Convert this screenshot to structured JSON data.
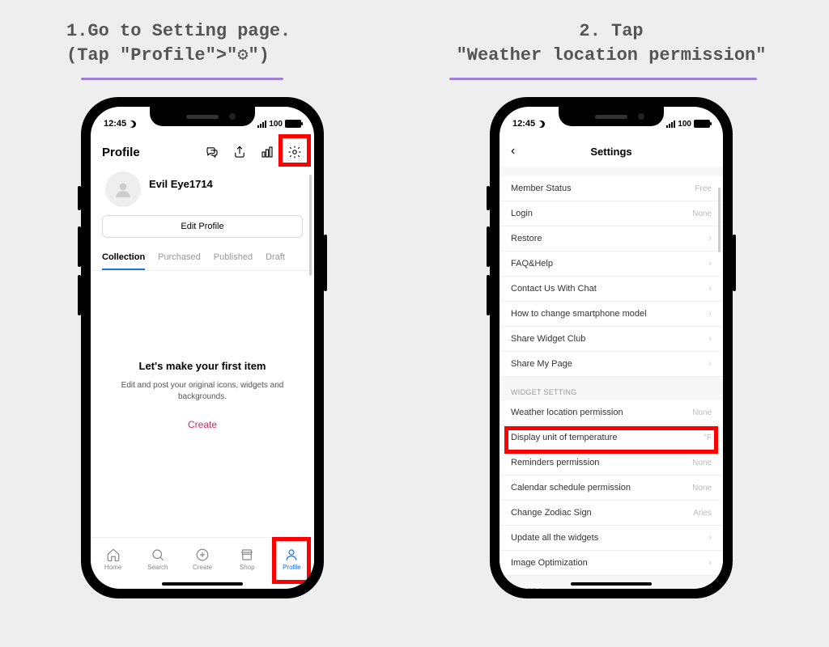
{
  "instructions": {
    "step1_line1": "1.Go to Setting page.",
    "step1_line2": "(Tap \"Profile\">\"⚙\")",
    "step2_line1": "2. Tap",
    "step2_line2": "\"Weather location permission\""
  },
  "status": {
    "time": "12:45",
    "battery": "100"
  },
  "profile": {
    "header_title": "Profile",
    "username": "Evil Eye1714",
    "edit_btn": "Edit Profile",
    "tabs": {
      "t0": "Collection",
      "t1": "Purchased",
      "t2": "Published",
      "t3": "Draft"
    },
    "empty_title": "Let's make your first item",
    "empty_desc": "Edit and post your original icons, widgets and backgrounds.",
    "empty_create": "Create"
  },
  "nav": {
    "n0": "Home",
    "n1": "Search",
    "n2": "Create",
    "n3": "Shop",
    "n4": "Profile"
  },
  "settings": {
    "title": "Settings",
    "items": {
      "i0": {
        "label": "Member Status",
        "val": "Free"
      },
      "i1": {
        "label": "Login",
        "val": "None"
      },
      "i2": {
        "label": "Restore",
        "val": ""
      },
      "i3": {
        "label": "FAQ&Help",
        "val": ""
      },
      "i4": {
        "label": "Contact Us With Chat",
        "val": ""
      },
      "i5": {
        "label": "How to change smartphone model",
        "val": ""
      },
      "i6": {
        "label": "Share Widget Club",
        "val": ""
      },
      "i7": {
        "label": "Share My Page",
        "val": ""
      },
      "i8": {
        "label": "Weather location permission",
        "val": "None"
      },
      "i9": {
        "label": "Display unit of temperature",
        "val": "°F"
      },
      "i10": {
        "label": "Reminders permission",
        "val": "None"
      },
      "i11": {
        "label": "Calendar schedule permission",
        "val": "None"
      },
      "i12": {
        "label": "Change Zodiac Sign",
        "val": "Aries"
      },
      "i13": {
        "label": "Update all the widgets",
        "val": ""
      },
      "i14": {
        "label": "Image Optimization",
        "val": ""
      }
    },
    "section1": "WIDGET SETTING",
    "section2": "OTHERS"
  }
}
